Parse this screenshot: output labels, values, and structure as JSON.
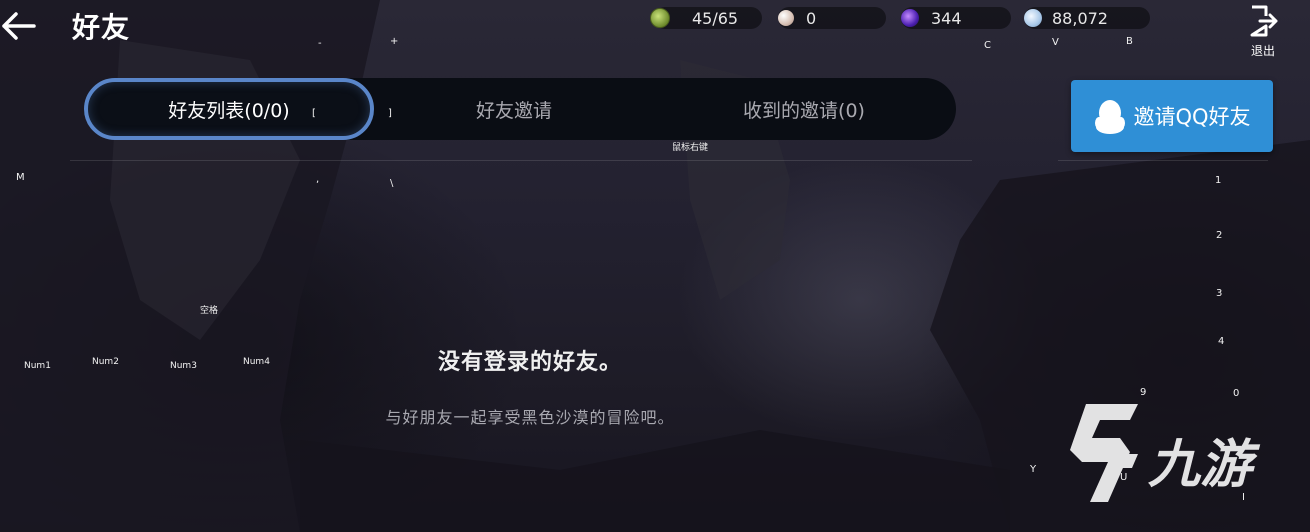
{
  "header": {
    "title": "好友",
    "exit_label": "退出"
  },
  "resources": [
    {
      "icon": "green-gem-icon",
      "value": "45/65"
    },
    {
      "icon": "pearl-icon",
      "value": "0"
    },
    {
      "icon": "purple-orb-icon",
      "value": "344"
    },
    {
      "icon": "silver-coin-icon",
      "value": "88,072"
    }
  ],
  "tabs": [
    {
      "label": "好友列表(0/0)",
      "active": true
    },
    {
      "label": "好友邀请",
      "active": false
    },
    {
      "label": "收到的邀请(0)",
      "active": false
    }
  ],
  "qq_button": {
    "label": "邀请QQ好友"
  },
  "empty_state": {
    "title": "没有登录的好友。",
    "subtitle": "与好朋友一起享受黑色沙漠的冒险吧。"
  },
  "key_hints": {
    "minus": "-",
    "plus": "+",
    "c": "C",
    "v": "V",
    "b": "B",
    "lbracket": "[",
    "rbracket": "]",
    "right_click": "鼠标右键",
    "m": "M",
    "comma": ",",
    "backslash": "\\",
    "space": "空格",
    "num1": "Num1",
    "num2": "Num2",
    "num3": "Num3",
    "num4": "Num4",
    "k1": "1",
    "k2": "2",
    "k3": "3",
    "k4": "4",
    "k9": "9",
    "k0": "0",
    "y": "Y",
    "u": "U",
    "i": "I"
  },
  "watermark": {
    "text": "九游"
  }
}
